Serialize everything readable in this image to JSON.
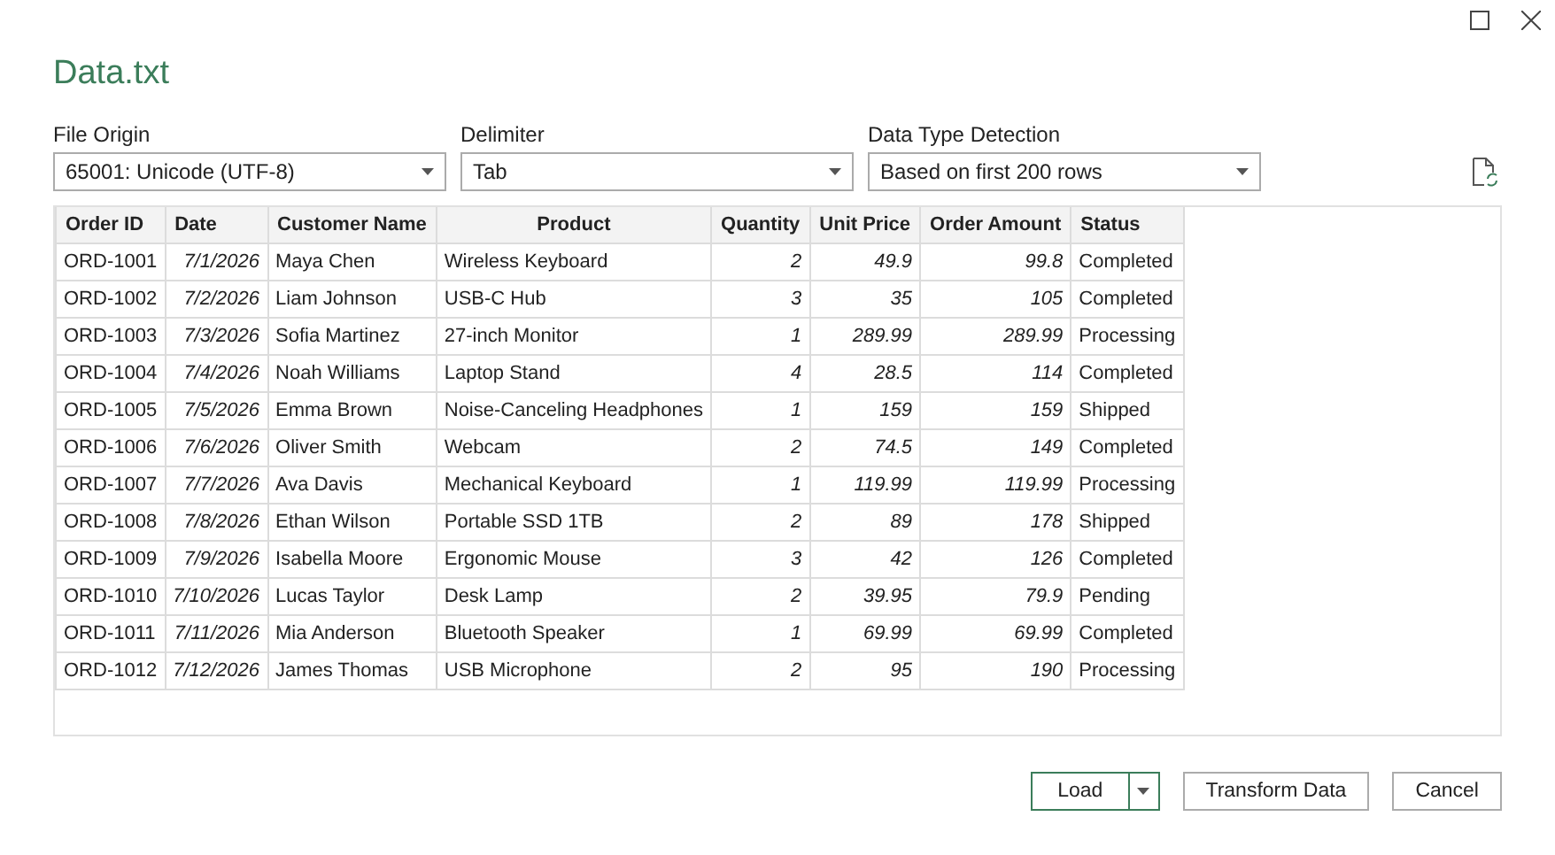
{
  "window": {
    "title": "Data.txt"
  },
  "options": [
    {
      "label": "File Origin",
      "value": "65001: Unicode (UTF-8)"
    },
    {
      "label": "Delimiter",
      "value": "Tab"
    },
    {
      "label": "Data Type Detection",
      "value": "Based on first 200 rows"
    }
  ],
  "table": {
    "columns": [
      {
        "label": "Order ID",
        "kind": "text"
      },
      {
        "label": "Date",
        "kind": "number"
      },
      {
        "label": "Customer Name",
        "kind": "text"
      },
      {
        "label": "Product",
        "kind": "text"
      },
      {
        "label": "Quantity",
        "kind": "number"
      },
      {
        "label": "Unit Price",
        "kind": "number"
      },
      {
        "label": "Order Amount",
        "kind": "number"
      },
      {
        "label": "Status",
        "kind": "text"
      }
    ],
    "rows": [
      [
        "ORD-1001",
        "7/1/2026",
        "Maya Chen",
        "Wireless Keyboard",
        "2",
        "49.9",
        "99.8",
        "Completed"
      ],
      [
        "ORD-1002",
        "7/2/2026",
        "Liam Johnson",
        "USB-C Hub",
        "3",
        "35",
        "105",
        "Completed"
      ],
      [
        "ORD-1003",
        "7/3/2026",
        "Sofia Martinez",
        "27-inch Monitor",
        "1",
        "289.99",
        "289.99",
        "Processing"
      ],
      [
        "ORD-1004",
        "7/4/2026",
        "Noah Williams",
        "Laptop Stand",
        "4",
        "28.5",
        "114",
        "Completed"
      ],
      [
        "ORD-1005",
        "7/5/2026",
        "Emma Brown",
        "Noise-Canceling Headphones",
        "1",
        "159",
        "159",
        "Shipped"
      ],
      [
        "ORD-1006",
        "7/6/2026",
        "Oliver Smith",
        "Webcam",
        "2",
        "74.5",
        "149",
        "Completed"
      ],
      [
        "ORD-1007",
        "7/7/2026",
        "Ava Davis",
        "Mechanical Keyboard",
        "1",
        "119.99",
        "119.99",
        "Processing"
      ],
      [
        "ORD-1008",
        "7/8/2026",
        "Ethan Wilson",
        "Portable SSD 1TB",
        "2",
        "89",
        "178",
        "Shipped"
      ],
      [
        "ORD-1009",
        "7/9/2026",
        "Isabella Moore",
        "Ergonomic Mouse",
        "3",
        "42",
        "126",
        "Completed"
      ],
      [
        "ORD-1010",
        "7/10/2026",
        "Lucas Taylor",
        "Desk Lamp",
        "2",
        "39.95",
        "79.9",
        "Pending"
      ],
      [
        "ORD-1011",
        "7/11/2026",
        "Mia Anderson",
        "Bluetooth Speaker",
        "1",
        "69.99",
        "69.99",
        "Completed"
      ],
      [
        "ORD-1012",
        "7/12/2026",
        "James Thomas",
        "USB Microphone",
        "2",
        "95",
        "190",
        "Processing"
      ]
    ]
  },
  "buttons": [
    {
      "label": "Load",
      "kind": "split"
    },
    {
      "label": "Transform Data",
      "kind": "plain"
    },
    {
      "label": "Cancel",
      "kind": "plain"
    }
  ]
}
